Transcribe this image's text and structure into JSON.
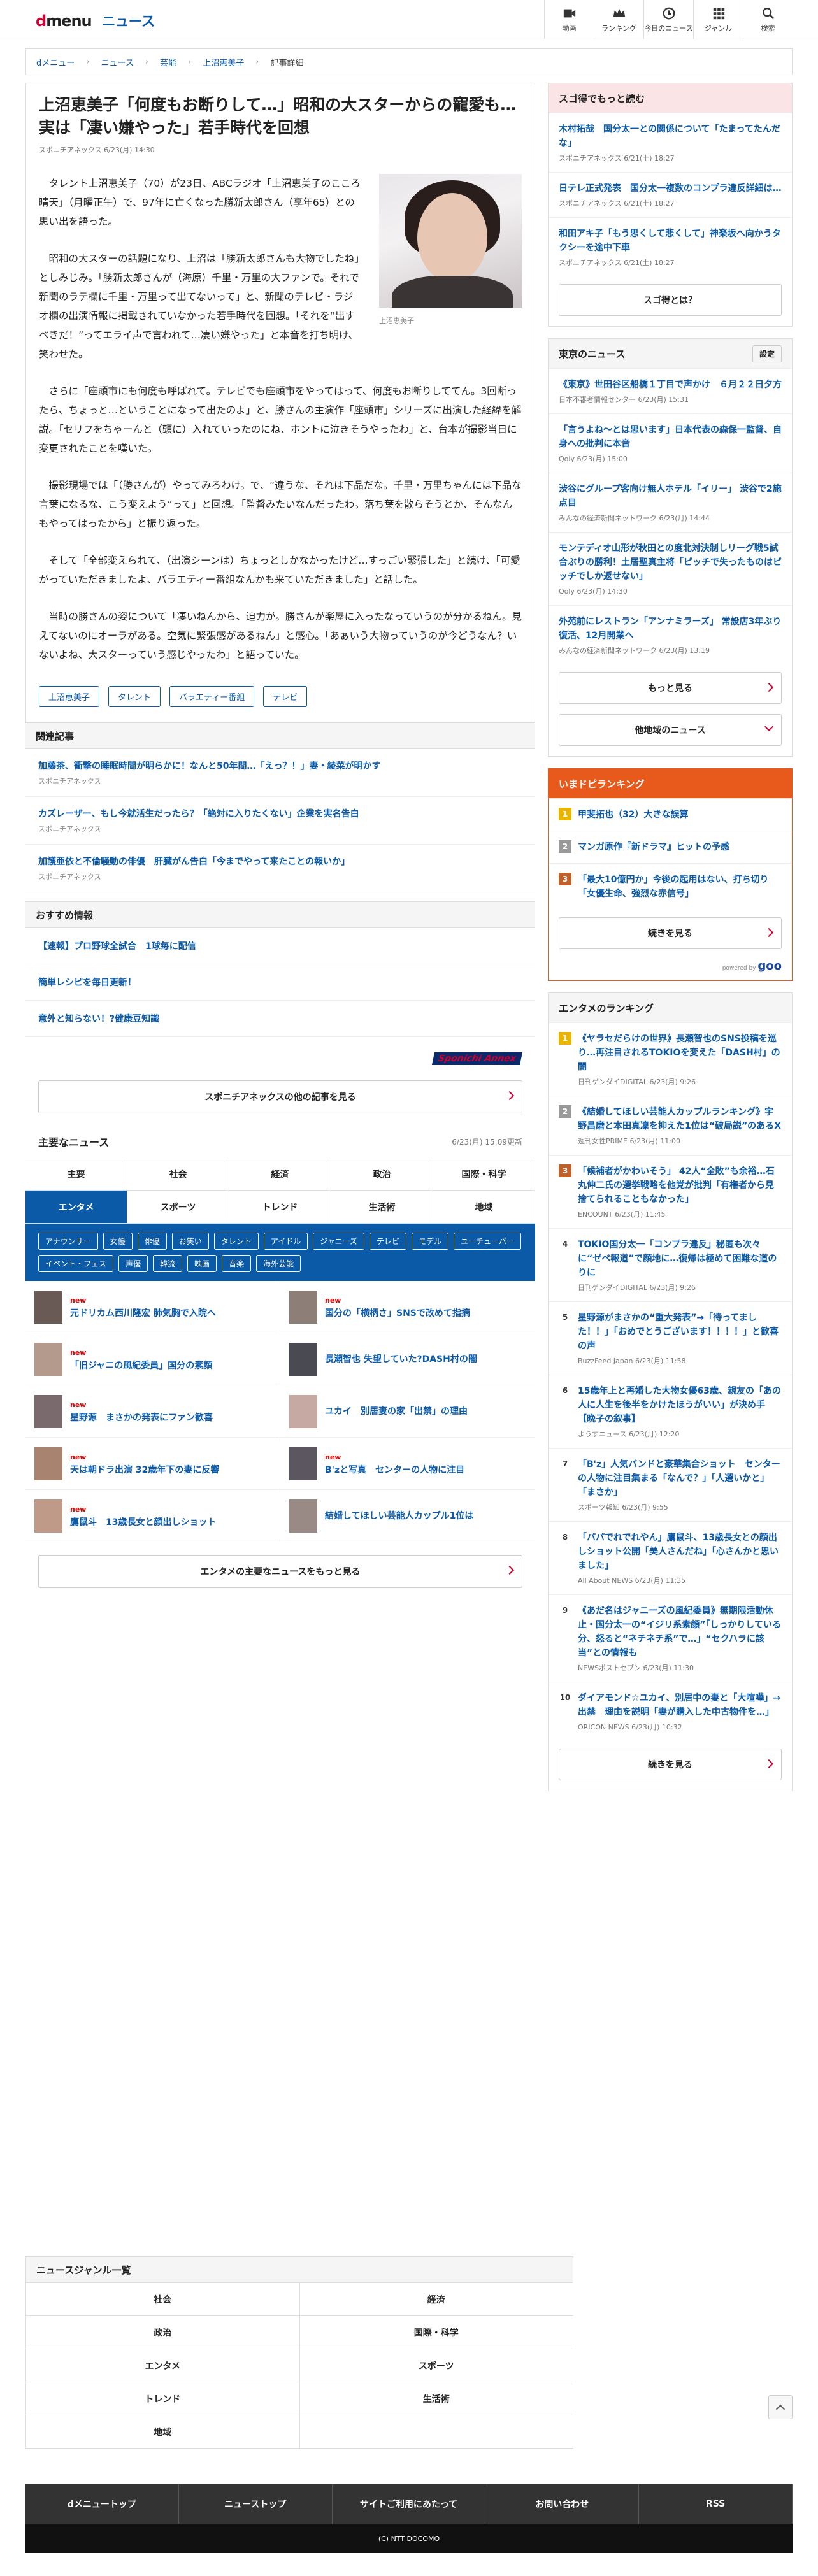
{
  "header": {
    "logo_d": "d",
    "logo_menu": "menu",
    "logo_news": "ニュース",
    "nav": [
      {
        "label": "動画",
        "icon": "video-icon"
      },
      {
        "label": "ランキング",
        "icon": "crown-icon"
      },
      {
        "label": "今日のニュース",
        "icon": "clock-icon"
      },
      {
        "label": "ジャンル",
        "icon": "grid-icon"
      },
      {
        "label": "検索",
        "icon": "search-icon"
      }
    ]
  },
  "breadcrumb": [
    "dメニュー",
    "ニュース",
    "芸能",
    "上沼恵美子",
    "記事詳細"
  ],
  "article": {
    "title": "上沼恵美子「何度もお断りして…」昭和の大スターからの寵愛も…実は「凄い嫌やった」若手時代を回想",
    "meta": "スポニチアネックス 6/23(月) 14:30",
    "photo_caption": "上沼恵美子",
    "paragraphs": [
      "タレント上沼恵美子（70）が23日、ABCラジオ「上沼恵美子のこころ晴天」（月曜正午）で、97年に亡くなった勝新太郎さん（享年65）との思い出を語った。",
      "昭和の大スターの話題になり、上沼は「勝新太郎さんも大物でしたね」としみじみ。「勝新太郎さんが（海原）千里・万里の大ファンで。それで新聞のラテ欄に千里・万里って出てないって」と、新聞のテレビ・ラジオ欄の出演情報に掲載されていなかった若手時代を回想。「それを“出すべきだ！”ってエライ声で言われて…凄い嫌やった」と本音を打ち明け、笑わせた。",
      "さらに「座頭市にも何度も呼ばれて。テレビでも座頭市をやってはって、何度もお断りしててん。3回断ったら、ちょっと…ということになって出たのよ」と、勝さんの主演作「座頭市」シリーズに出演した経緯を解説。「セリフをちゃーんと（頭に）入れていったのにね、ホントに泣きそうやったわ」と、台本が撮影当日に変更されたことを嘆いた。",
      "撮影現場では「（勝さんが）やってみろわけ。で、“違うな、それは下品だな。千里・万里ちゃんには下品な言葉になるな、こう変えよう”って」と回想。「監督みたいなんだったわ。落ち葉を散らそうとか、そんなんもやってはったから」と振り返った。",
      "そして「全部変えられて、（出演シーンは）ちょっとしかなかったけど…すっごい緊張した」と続け、「可愛がっていただきましたよ、バラエティー番組なんかも来ていただきました」と話した。",
      "当時の勝さんの姿について「凄いねんから、迫力が。勝さんが楽屋に入ったなっていうのが分かるねん。見えてないのにオーラがある。空気に緊張感があるねん」と感心。「あぁいう大物っていうのが今どうなん？いないよね、大スターっていう感じやったわ」と語っていた。"
    ],
    "tags": [
      "上沼恵美子",
      "タレント",
      "バラエティー番組",
      "テレビ"
    ]
  },
  "related": {
    "heading": "関連記事",
    "items": [
      {
        "title": "加藤茶、衝撃の睡眠時間が明らかに！なんと50年間…「えっ？！」妻・綾菜が明かす",
        "source": "スポニチアネックス"
      },
      {
        "title": "カズレーザー、もし今就活生だったら？「絶対に入りたくない」企業を実名告白",
        "source": "スポニチアネックス"
      },
      {
        "title": "加護亜依と不倫騒動の俳優　肝臓がん告白「今までやって来たことの報いか」",
        "source": "スポニチアネックス"
      }
    ]
  },
  "recommend": {
    "heading": "おすすめ情報",
    "items": [
      "【速報】プロ野球全試合　1球毎に配信",
      "簡単レシピを毎日更新！",
      "意外と知らない！?健康豆知識"
    ]
  },
  "publisher_logo": "Sponichi Annex",
  "publisher_more": "スポニチアネックスの他の記事を見る",
  "major": {
    "heading": "主要なニュース",
    "updated": "6/23(月) 15:09更新",
    "tabs_row1": [
      "主要",
      "社会",
      "経済",
      "政治",
      "国際・科学"
    ],
    "tabs_row2": [
      "エンタメ",
      "スポーツ",
      "トレンド",
      "生活術",
      "地域"
    ],
    "subtags": [
      "アナウンサー",
      "女優",
      "俳優",
      "お笑い",
      "タレント",
      "アイドル",
      "ジャニーズ",
      "テレビ",
      "モデル",
      "ユーチューバー",
      "イベント・フェス",
      "声優",
      "韓流",
      "映画",
      "音楽",
      "海外芸能"
    ],
    "new_label": "new",
    "items": [
      {
        "title": "元ドリカム西川隆宏 肺気胸で入院へ",
        "new": true
      },
      {
        "title": "国分の「横柄さ」SNSで改めて指摘",
        "new": true
      },
      {
        "title": "「旧ジャニの風紀委員」国分の素顔",
        "new": true
      },
      {
        "title": "長瀬智也 失望していた?DASH村の闇",
        "new": false
      },
      {
        "title": "星野源　まさかの発表にファン歓喜",
        "new": true
      },
      {
        "title": "ユカイ　別居妻の家「出禁」の理由",
        "new": false
      },
      {
        "title": "天は朝ドラ出演 32歳年下の妻に反響",
        "new": true
      },
      {
        "title": "B'zと写真　センターの人物に注目",
        "new": true
      },
      {
        "title": "鷹鼠斗　13歳長女と顔出しショット",
        "new": true
      },
      {
        "title": "結婚してほしい芸能人カップル1位は",
        "new": false
      }
    ],
    "more": "エンタメの主要なニュースをもっと見る"
  },
  "right": {
    "sugoi": {
      "heading": "スゴ得でもっと読む",
      "items": [
        {
          "title": "木村拓哉　国分太一との関係について「たまってたんだな」",
          "source": "スポニチアネックス 6/21(土) 18:27"
        },
        {
          "title": "日テレ正式発表　国分太一複数のコンプラ違反詳細は…",
          "source": "スポニチアネックス 6/21(土) 18:27"
        },
        {
          "title": "和田アキ子「もう思くして悲くして」神楽坂へ向かうタクシーを途中下車",
          "source": "スポニチアネックス 6/21(土) 18:27"
        }
      ],
      "about": "スゴ得とは？"
    },
    "tokyo": {
      "heading": "東京のニュース",
      "setting": "設定",
      "items": [
        {
          "title": "《東京》世田谷区船橋１丁目で声かけ　６月２２日夕方",
          "source": "日本不審者情報センター 6/23(月) 15:31"
        },
        {
          "title": "「言うよね～とは思います」日本代表の森保一監督、自身への批判に本音",
          "source": "Qoly 6/23(月) 15:00"
        },
        {
          "title": "渋谷にグループ客向け無人ホテル「イリー」 渋谷で2施点目",
          "source": "みんなの経済新聞ネットワーク 6/23(月) 14:44"
        },
        {
          "title": "モンテディオ山形が秋田との度北対決制しリーグ戦5試合ぶりの勝利！土居聖真主将「ピッチで失ったものはピッチでしか返せない」",
          "source": "Qoly 6/23(月) 14:30"
        },
        {
          "title": "外苑前にレストラン「アンナミラーズ」 常設店3年ぶり復活、12月開業へ",
          "source": "みんなの経済新聞ネットワーク 6/23(月) 13:19"
        }
      ],
      "more": "もっと見る",
      "other": "他地域のニュース"
    },
    "hot": {
      "heading": "いまドピランキング",
      "items": [
        "甲斐拓也（32）大きな誤算",
        "マンガ原作『新ドラマ』ヒットの予感",
        "「最大10億円か」今後の起用はない、打ち切り「女優生命、強烈な赤信号」"
      ],
      "more": "続きを見る",
      "powered": "powered by",
      "brand": "goo"
    },
    "ent": {
      "heading": "エンタメのランキング",
      "items": [
        {
          "title": "《ヤラセだらけの世界》長瀬智也のSNS投稿を巡り…再注目されるTOKIOを変えた「DASH村」の闇",
          "source": "日刊ゲンダイDIGITAL 6/23(月) 9:26"
        },
        {
          "title": "《結婚してほしい芸能人カップルランキング》宇野昌磨と本田真凜を抑えた1位は“破局説”のあるX",
          "source": "週刊女性PRIME 6/23(月) 11:00"
        },
        {
          "title": "「候補者がかわいそう」 42人“全敗”も余裕…石丸伸二氏の選挙戦略を他党が批判「有権者から見捨てられることもなかった」",
          "source": "ENCOUNT 6/23(月) 11:45"
        },
        {
          "title": "TOKIO国分太一「コンプラ違反」秘匿も次々に“ゼペ報道”で顔地に…復帰は極めて困難な道のりに",
          "source": "日刊ゲンダイDIGITAL 6/23(月) 9:26"
        },
        {
          "title": "星野源がまさかの“重大発表”→「待ってました！！」「おめでとうございます！！！！」と歓喜の声",
          "source": "BuzzFeed Japan 6/23(月) 11:58"
        },
        {
          "title": "15歳年上と再婚した大物女優63歳、親友の「あの人に人生を後半をかけたほうがいい」が決め手【晩子の叙事】",
          "source": "ようすニュース 6/23(月) 12:20"
        },
        {
          "title": "「B'z」人気バンドと豪華集合ショット　センターの人物に注目集まる「なんで？」「人選いかと」「まさか」",
          "source": "スポーツ報知 6/23(月) 9:55"
        },
        {
          "title": "「パパでれでれやん」鷹鼠斗、13歳長女との顔出しショット公開「美人さんだね」「心さんかと思いました」",
          "source": "All About NEWS 6/23(月) 11:35"
        },
        {
          "title": "《あだ名はジャニーズの風紀委員》無期限活動休止・国分太一の“イジリ系素顔”「しっかりしている分、怒ると“ネチネチ系”で…」“セクハラに該当”との情報も",
          "source": "NEWSポストセブン 6/23(月) 11:30"
        },
        {
          "title": "ダイアモンド☆ユカイ、別居中の妻と「大喧嘩」→出禁　理由を説明「妻が購入した中古物件を…」",
          "source": "ORICON NEWS 6/23(月) 10:32"
        }
      ],
      "more": "続きを見る"
    }
  },
  "genre": {
    "heading": "ニュースジャンル一覧",
    "items": [
      "社会",
      "経済",
      "政治",
      "国際・科学",
      "エンタメ",
      "スポーツ",
      "トレンド",
      "生活術",
      "地域",
      ""
    ]
  },
  "footer": {
    "links": [
      "dメニュートップ",
      "ニューストップ",
      "サイトご利用にあたって",
      "お問い合わせ",
      "RSS"
    ],
    "copyright": "(C) NTT DOCOMO"
  },
  "colors": {
    "brand_red": "#cc0033",
    "link_blue": "#0b5aa8",
    "ranking_orange": "#e85a1b",
    "sugoi_pink": "#fbe4e6"
  }
}
